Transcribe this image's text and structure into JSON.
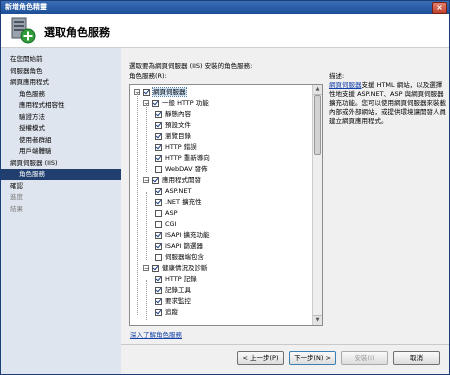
{
  "window": {
    "title": "新增角色精靈",
    "close_label": "×"
  },
  "header": {
    "title": "選取角色服務",
    "icon": "server-role-wizard-icon"
  },
  "nav": {
    "items": [
      {
        "label": "在您開始前",
        "indent": 0,
        "state": "normal"
      },
      {
        "label": "伺服器角色",
        "indent": 0,
        "state": "normal"
      },
      {
        "label": "網頁應用程式",
        "indent": 0,
        "state": "normal"
      },
      {
        "label": "角色服務",
        "indent": 1,
        "state": "normal"
      },
      {
        "label": "應用程式相容性",
        "indent": 1,
        "state": "normal"
      },
      {
        "label": "驗證方法",
        "indent": 1,
        "state": "normal"
      },
      {
        "label": "授權模式",
        "indent": 1,
        "state": "normal"
      },
      {
        "label": "使用者群組",
        "indent": 1,
        "state": "normal"
      },
      {
        "label": "用戶端體驗",
        "indent": 1,
        "state": "normal"
      },
      {
        "label": "網頁伺服器 (IIS)",
        "indent": 0,
        "state": "normal"
      },
      {
        "label": "角色服務",
        "indent": 1,
        "state": "selected"
      },
      {
        "label": "確認",
        "indent": 0,
        "state": "normal"
      },
      {
        "label": "進度",
        "indent": 0,
        "state": "disabled"
      },
      {
        "label": "結果",
        "indent": 0,
        "state": "disabled"
      }
    ]
  },
  "content": {
    "instruction": "選取要為網頁伺服器 (IIS) 安裝的角色服務:",
    "roles_label": "角色服務(R):",
    "tree": [
      {
        "label": "網頁伺服器",
        "level": 0,
        "expander": "−",
        "checked": true,
        "selected": true
      },
      {
        "label": "一般 HTTP 功能",
        "level": 1,
        "expander": "−",
        "checked": true
      },
      {
        "label": "靜態內容",
        "level": 2,
        "checked": true
      },
      {
        "label": "預設文件",
        "level": 2,
        "checked": true
      },
      {
        "label": "瀏覽目錄",
        "level": 2,
        "checked": true
      },
      {
        "label": "HTTP 錯誤",
        "level": 2,
        "checked": true
      },
      {
        "label": "HTTP 重新導向",
        "level": 2,
        "checked": true
      },
      {
        "label": "WebDAV 發佈",
        "level": 2,
        "checked": false
      },
      {
        "label": "應用程式開發",
        "level": 1,
        "expander": "−",
        "checked": true
      },
      {
        "label": "ASP.NET",
        "level": 2,
        "checked": true
      },
      {
        "label": ".NET 擴充性",
        "level": 2,
        "checked": true
      },
      {
        "label": "ASP",
        "level": 2,
        "checked": false
      },
      {
        "label": "CGI",
        "level": 2,
        "checked": false
      },
      {
        "label": "ISAPI 擴充功能",
        "level": 2,
        "checked": true
      },
      {
        "label": "ISAPI 篩選器",
        "level": 2,
        "checked": true
      },
      {
        "label": "伺服器端包含",
        "level": 2,
        "checked": false
      },
      {
        "label": "健康情況及診斷",
        "level": 1,
        "expander": "−",
        "checked": true
      },
      {
        "label": "HTTP 記錄",
        "level": 2,
        "checked": true
      },
      {
        "label": "記錄工具",
        "level": 2,
        "checked": true
      },
      {
        "label": "要求監控",
        "level": 2,
        "checked": true
      },
      {
        "label": "追蹤",
        "level": 2,
        "checked": true
      }
    ],
    "more_link": "深入了解角色服務",
    "description": {
      "title": "描述:",
      "link_text": "網頁伺服器",
      "text": "支援 HTML 網站，以及選擇性地支援 ASP.NET、ASP 與網頁伺服器擴充功能。您可以使用網頁伺服器來裝載內部或外部網站，或提供環境讓開發人員建立網頁應用程式。"
    }
  },
  "buttons": {
    "back": "< 上一步(P)",
    "next": "下一步(N) >",
    "install": "安裝(I)",
    "cancel": "取消"
  }
}
